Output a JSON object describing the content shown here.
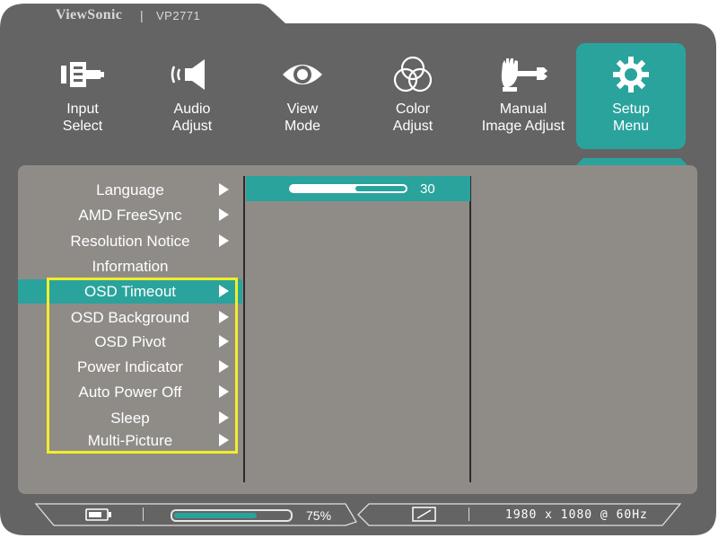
{
  "header": {
    "brand": "ViewSonic",
    "separator": "|",
    "model": "VP2771"
  },
  "tabs": [
    {
      "name": "input-select",
      "line1": "Input",
      "line2": "Select",
      "icon": "input-plug-icon",
      "active": false
    },
    {
      "name": "audio-adjust",
      "line1": "Audio",
      "line2": "Adjust",
      "icon": "speaker-icon",
      "active": false
    },
    {
      "name": "view-mode",
      "line1": "View",
      "line2": "Mode",
      "icon": "eye-icon",
      "active": false
    },
    {
      "name": "color-adjust",
      "line1": "Color",
      "line2": "Adjust",
      "icon": "rgb-circles-icon",
      "active": false
    },
    {
      "name": "manual-image-adjust",
      "line1": "Manual",
      "line2": "Image Adjust",
      "icon": "hand-wrench-icon",
      "active": false
    },
    {
      "name": "setup-menu",
      "line1": "Setup",
      "line2": "Menu",
      "icon": "gear-icon",
      "active": true
    }
  ],
  "menu": [
    {
      "label": "Language",
      "arrow": true
    },
    {
      "label": "AMD FreeSync",
      "arrow": true
    },
    {
      "label": "Resolution Notice",
      "arrow": true
    },
    {
      "label": "Information",
      "arrow": false
    },
    {
      "label": "OSD Timeout",
      "arrow": true,
      "selected": true
    },
    {
      "label": "OSD Background",
      "arrow": true
    },
    {
      "label": "OSD Pivot",
      "arrow": true
    },
    {
      "label": "Power Indicator",
      "arrow": true
    },
    {
      "label": "Auto Power Off",
      "arrow": true
    },
    {
      "label": "Sleep",
      "arrow": true
    },
    {
      "label": "Multi-Picture",
      "arrow": true
    }
  ],
  "osd_timeout": {
    "value": "30",
    "slider_fraction": 0.55
  },
  "status_bar": {
    "battery_icon": "battery-icon",
    "brightness_percent": "75%",
    "brightness_fraction": 0.75,
    "display_icon": "aspect-ratio-icon",
    "resolution": "1980 x 1080 @ 60Hz"
  },
  "colors": {
    "accent": "#2aa39d",
    "frame": "#646464",
    "panel": "#8f8c88",
    "highlight": "#f2ee2a"
  }
}
